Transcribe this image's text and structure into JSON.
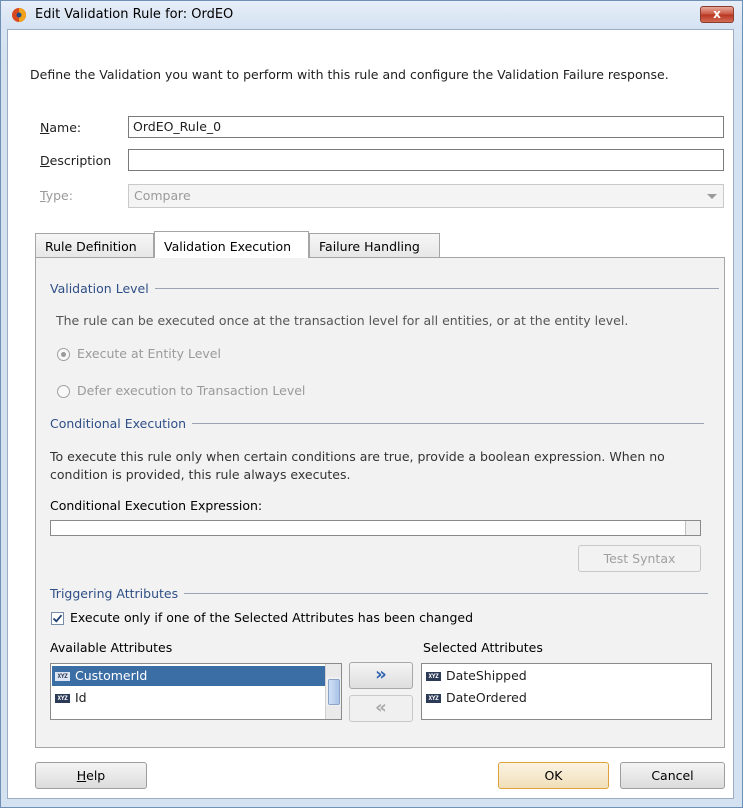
{
  "window": {
    "title": "Edit Validation Rule for: OrdEO",
    "close_glyph": "x"
  },
  "intro": "Define the Validation you want to perform with this rule and configure the Validation Failure response.",
  "form": {
    "name_label": "Name:",
    "name_value": "OrdEO_Rule_0",
    "description_label": "Description",
    "description_value": "",
    "type_label": "Type:",
    "type_value": "Compare"
  },
  "tabs": [
    {
      "label": "Rule Definition",
      "active": false
    },
    {
      "label": "Validation Execution",
      "active": true
    },
    {
      "label": "Failure Handling",
      "active": false
    }
  ],
  "validation_level": {
    "heading": "Validation Level",
    "description": "The rule can be executed once at the transaction level for all entities, or at the entity level.",
    "options": [
      {
        "label": "Execute at Entity Level",
        "selected": true,
        "enabled": false
      },
      {
        "label": "Defer execution to Transaction Level",
        "selected": false,
        "enabled": false
      }
    ]
  },
  "conditional_execution": {
    "heading": "Conditional Execution",
    "description_line1": "To execute this rule only when certain conditions are true, provide a boolean expression. When no",
    "description_line2": "condition is provided, this rule always executes.",
    "expression_label": "Conditional Execution Expression:",
    "expression_value": "",
    "test_syntax_label": "Test Syntax"
  },
  "triggering_attributes": {
    "heading": "Triggering Attributes",
    "checkbox_label": "Execute only if one of the Selected Attributes has been changed",
    "checkbox_checked": true,
    "available_label": "Available Attributes",
    "selected_label": "Selected Attributes",
    "available": [
      {
        "name": "CustomerId",
        "selected": true
      },
      {
        "name": "Id",
        "selected": false
      }
    ],
    "selected": [
      {
        "name": "DateShipped"
      },
      {
        "name": "DateOrdered"
      }
    ],
    "type_icon_text": "XYZ",
    "move_right_glyph": "»",
    "move_left_glyph": "«"
  },
  "footer": {
    "help_label": "Help",
    "ok_label": "OK",
    "cancel_label": "Cancel"
  },
  "colors": {
    "accent": "#3b6ea5",
    "section_heading": "#2f4f87",
    "default_button_border": "#e0a33b",
    "close_button": "#c8533f"
  }
}
